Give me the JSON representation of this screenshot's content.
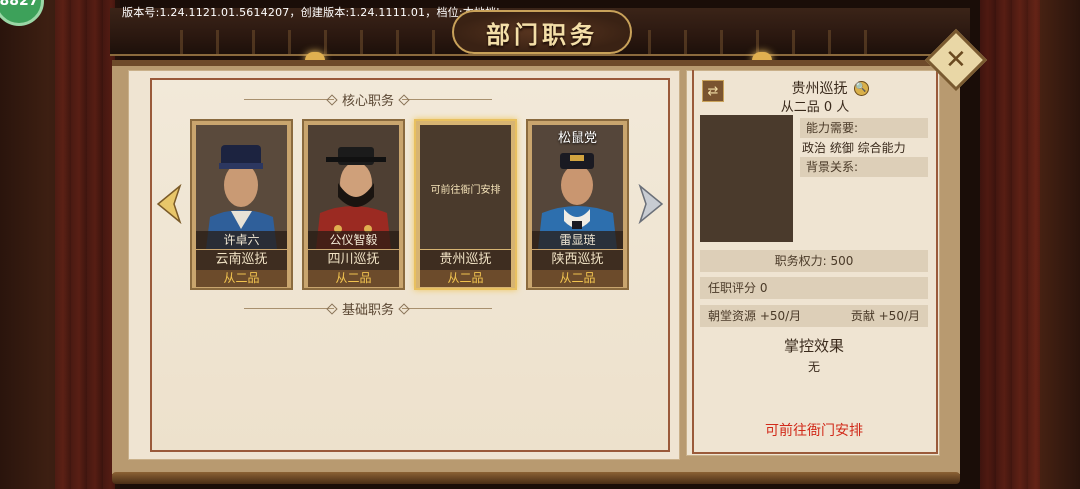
{
  "status": {
    "fps": "8827",
    "version_line": "版本号:1.24.1121.01.5614207，创建版本:1.24.1111.01，档位:本地档'"
  },
  "header": {
    "title": "部门职务"
  },
  "core_section": {
    "label": "核心职务"
  },
  "basic_section": {
    "label": "基础职务"
  },
  "cards": [
    {
      "name": "许卓六",
      "post": "云南巡抚",
      "rank": "从二品",
      "faction": "",
      "empty_text": "",
      "robe": "#2f5f9a",
      "hat": "#1c2340"
    },
    {
      "name": "公仪智毅",
      "post": "四川巡抚",
      "rank": "从二品",
      "faction": "",
      "empty_text": "",
      "robe": "#9b2a22",
      "hat": "#1b1b1b"
    },
    {
      "name": "",
      "post": "贵州巡抚",
      "rank": "从二品",
      "faction": "",
      "empty_text": "可前往衙门安排",
      "robe": "",
      "hat": ""
    },
    {
      "name": "雷显琏",
      "post": "陕西巡抚",
      "rank": "从二品",
      "faction": "松鼠党",
      "empty_text": "",
      "robe": "#2d6fae",
      "hat": "#1a1a22"
    }
  ],
  "detail": {
    "title": "贵州巡抚",
    "count": "从二品 0 人",
    "ability_label": "能力需要:",
    "abilities": "政治  统御  综合能力",
    "background_label": "背景关系:",
    "power": "职务权力:  500",
    "score": "任职评分   0",
    "resource": "朝堂资源 +50/月",
    "contribution": "贡献 +50/月",
    "effect_title": "掌控效果",
    "effect_value": "无",
    "goto": "可前往衙门安排"
  },
  "colors": {
    "accent": "#c9a25a",
    "link_red": "#d12a1a",
    "rank_gold": "#f1c34f"
  }
}
